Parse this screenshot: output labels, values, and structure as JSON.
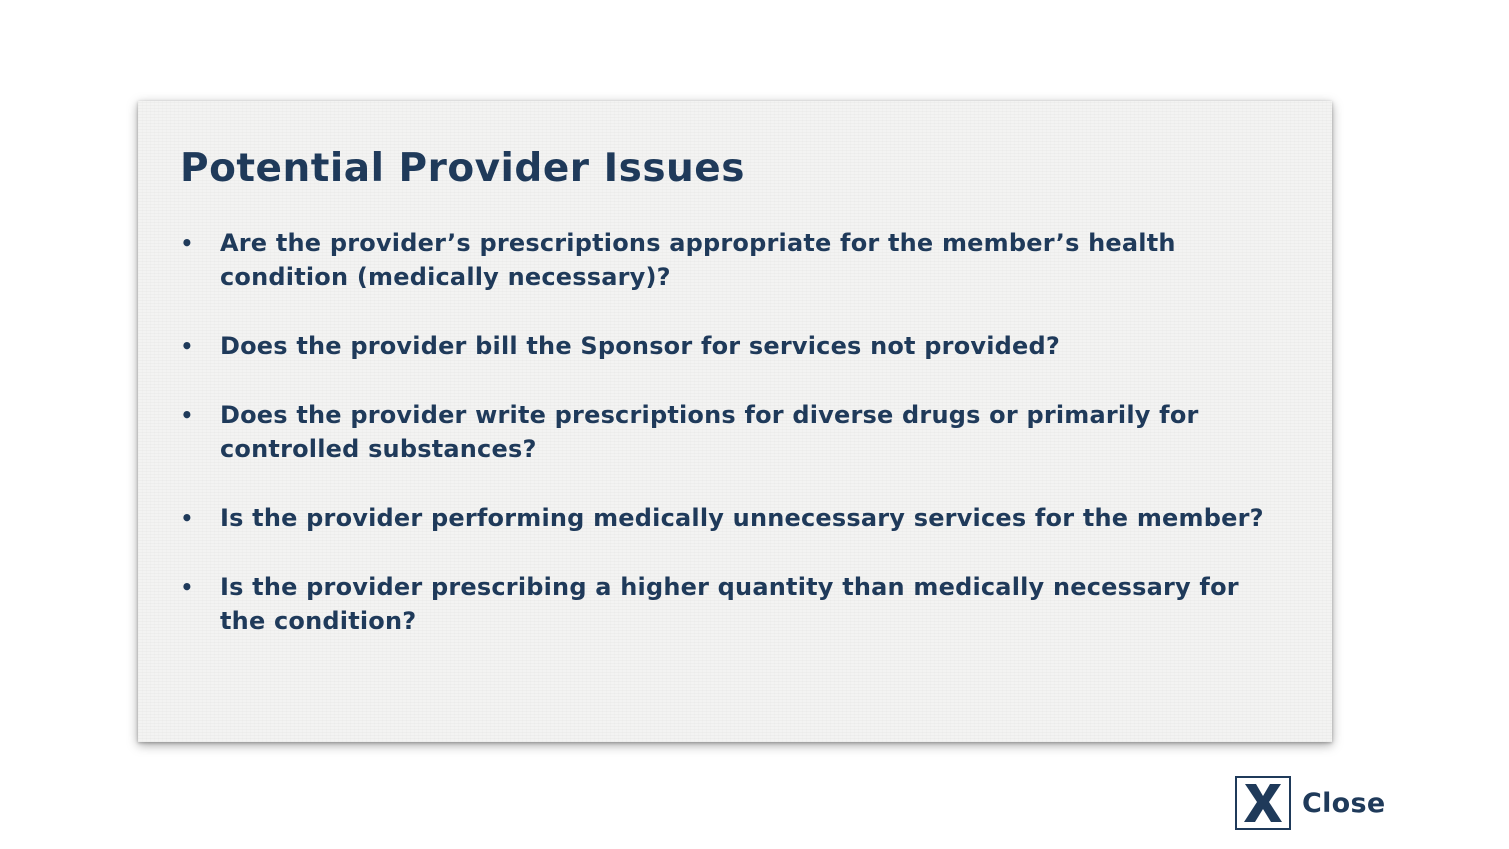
{
  "slide": {
    "title": "Potential Provider Issues",
    "bullet_symbol": "•",
    "bullets": [
      {
        "text": "Are the provider’s prescriptions appropriate for the member’s health condition (medically necessary)?"
      },
      {
        "text": "Does the provider bill the Sponsor for services not provided?"
      },
      {
        "text": "Does the provider write prescriptions for diverse drugs or primarily for controlled substances?"
      },
      {
        "text": "Is the provider performing medically unnecessary services for the member?"
      },
      {
        "text": "Is the provider prescribing a higher quantity than medically necessary for the condition?"
      }
    ]
  },
  "close_button": {
    "label": "Close",
    "icon": "close-x-icon"
  },
  "colors": {
    "text": "#1f3a5a",
    "card_background": "#f3f3f2",
    "page_background": "#ffffff"
  }
}
